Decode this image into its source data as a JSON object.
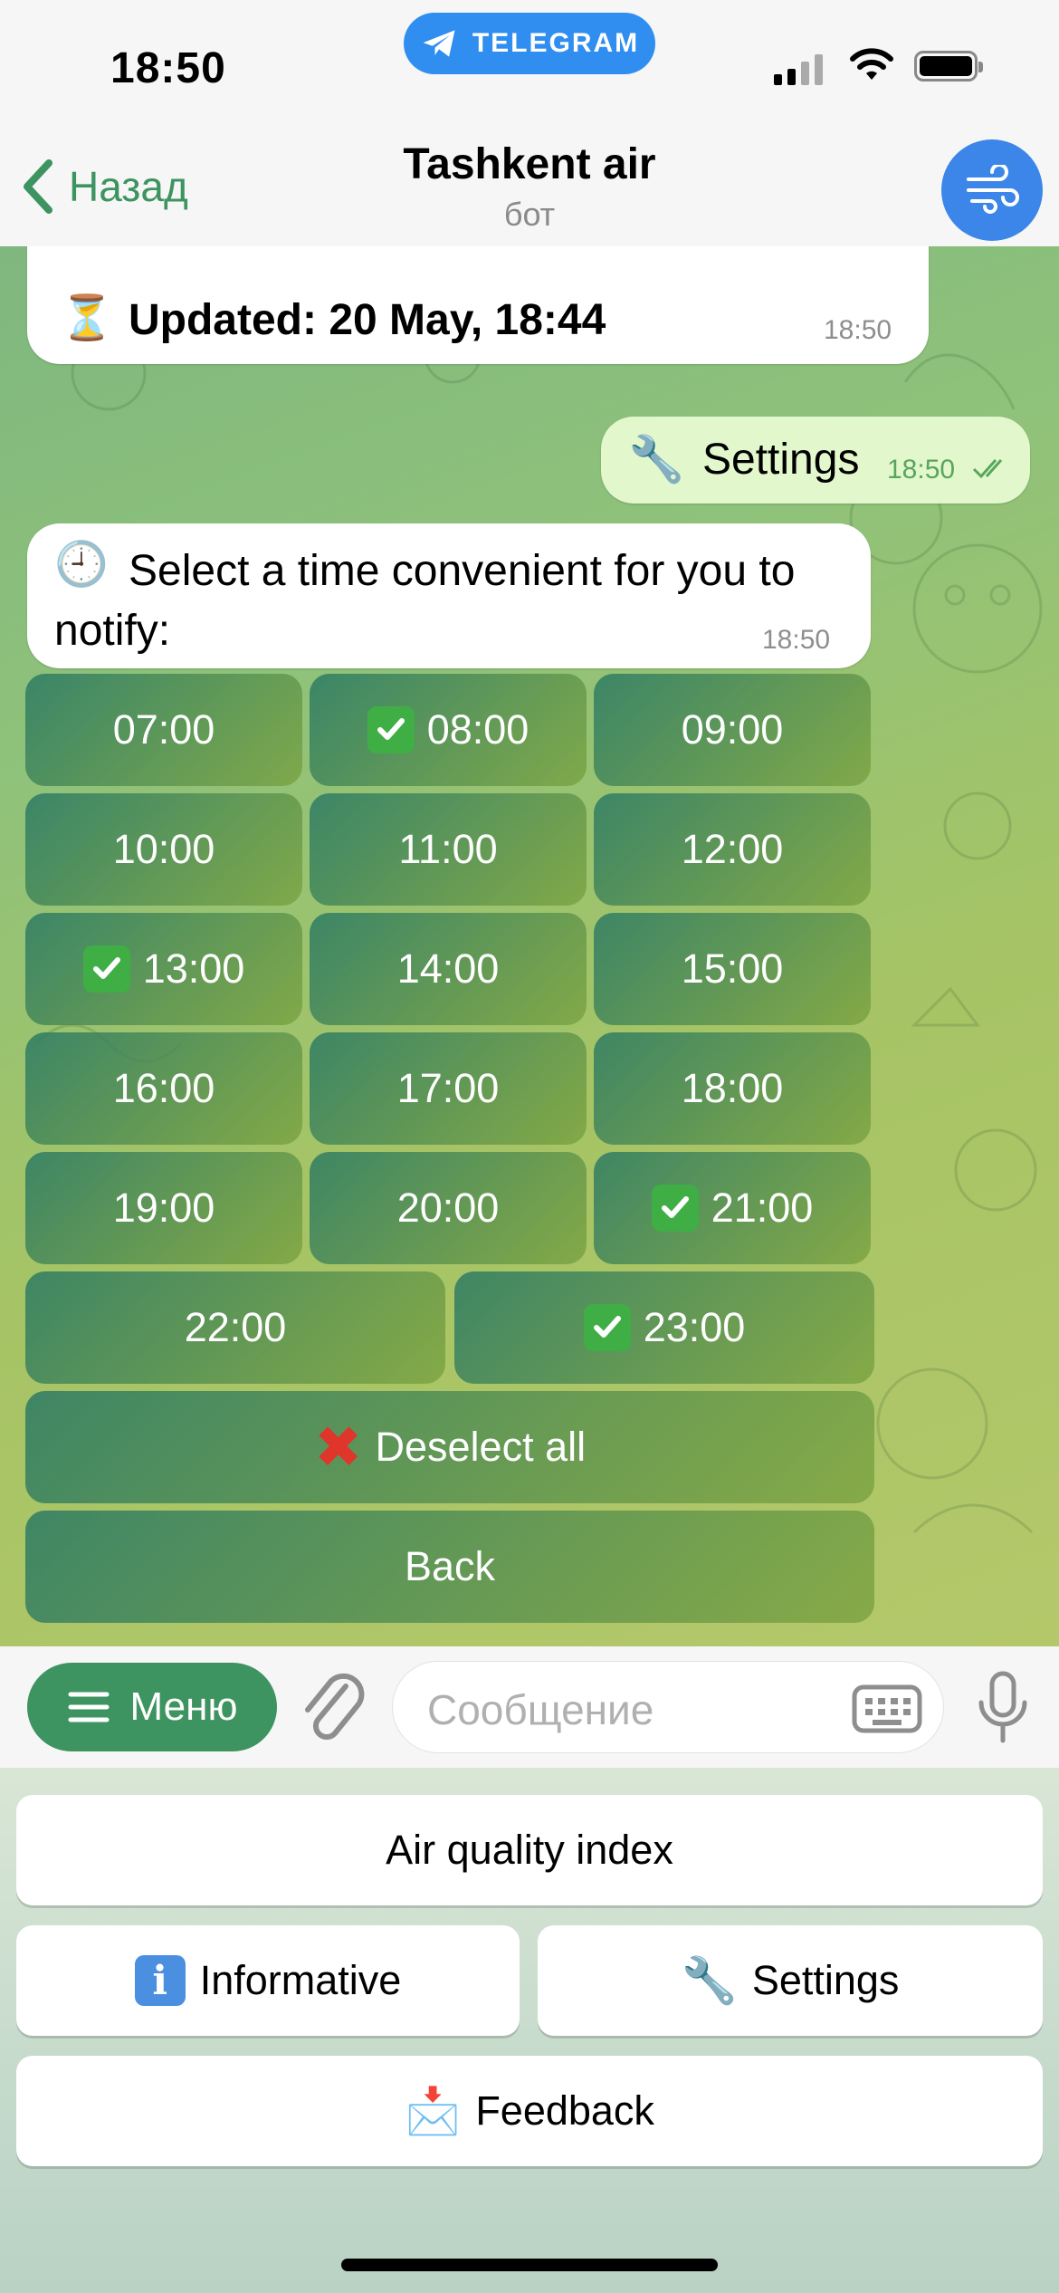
{
  "status": {
    "time": "18:50",
    "pill_label": "TELEGRAM"
  },
  "header": {
    "back_label": "Назад",
    "title": "Tashkent air",
    "subtitle": "бот"
  },
  "messages": {
    "updated": {
      "text": "Updated: 20 May, 18:44",
      "time": "18:50",
      "icon": "hourglass-icon"
    },
    "settings_out": {
      "text": "Settings",
      "time": "18:50",
      "icon": "wrench-icon"
    },
    "select_time": {
      "text": "Select a time convenient for you to notify:",
      "time": "18:50",
      "icon": "clock-icon"
    }
  },
  "inline_keyboard": {
    "times": [
      {
        "label": "07:00",
        "checked": false
      },
      {
        "label": "08:00",
        "checked": true
      },
      {
        "label": "09:00",
        "checked": false
      },
      {
        "label": "10:00",
        "checked": false
      },
      {
        "label": "11:00",
        "checked": false
      },
      {
        "label": "12:00",
        "checked": false
      },
      {
        "label": "13:00",
        "checked": true
      },
      {
        "label": "14:00",
        "checked": false
      },
      {
        "label": "15:00",
        "checked": false
      },
      {
        "label": "16:00",
        "checked": false
      },
      {
        "label": "17:00",
        "checked": false
      },
      {
        "label": "18:00",
        "checked": false
      },
      {
        "label": "19:00",
        "checked": false
      },
      {
        "label": "20:00",
        "checked": false
      },
      {
        "label": "21:00",
        "checked": true
      },
      {
        "label": "22:00",
        "checked": false
      },
      {
        "label": "23:00",
        "checked": true
      }
    ],
    "deselect_label": "Deselect all",
    "back_label": "Back"
  },
  "input": {
    "menu_label": "Меню",
    "placeholder": "Сообщение"
  },
  "reply_keyboard": {
    "air_quality": "Air quality index",
    "informative": "Informative",
    "settings": "Settings",
    "feedback": "Feedback"
  },
  "colors": {
    "accent": "#3d9460",
    "telegram_blue": "#2f8ef0",
    "check_green": "#3fae45"
  }
}
